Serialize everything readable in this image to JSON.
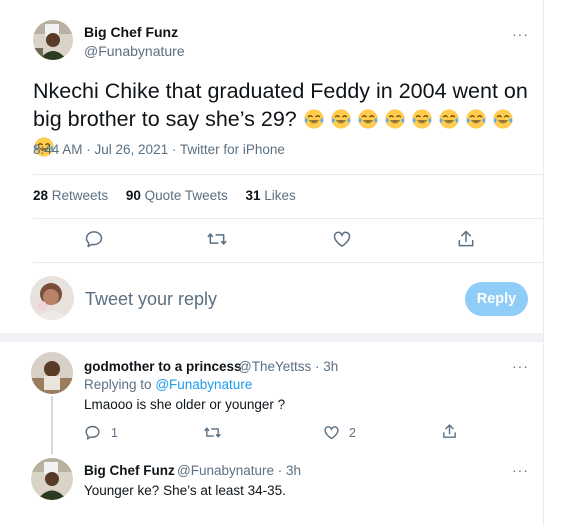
{
  "tweet": {
    "author_name": "Big Chef Funz",
    "author_handle": "@Funabynature",
    "text": "Nkechi Chike that graduated Feddy in 2004 went on big brother to say she’s 29?",
    "emoji_count_icons": "face-with-tears-of-joy",
    "timestamp": "8:44 AM · Jul 26, 2021 · Twitter for iPhone",
    "retweets_num": "28",
    "retweets_label": "Retweets",
    "quotes_num": "90",
    "quotes_label": "Quote Tweets",
    "likes_num": "31",
    "likes_label": "Likes",
    "more": "···"
  },
  "composer": {
    "placeholder": "Tweet your reply",
    "reply_button": "Reply"
  },
  "replies": [
    {
      "author_name": "godmother to a princess",
      "author_handle": "@TheYettss · 3h",
      "replying_prefix": "Replying to",
      "replying_to": "@Funabynature",
      "text": "Lmaooo is she older or younger ?",
      "reply_count": "1",
      "like_count": "2",
      "more": "···"
    },
    {
      "author_name": "Big Chef Funz",
      "author_handle": "@Funabynature · 3h",
      "text": "Younger ke? She’s at least 34-35.",
      "more": "···"
    }
  ],
  "colors": {
    "accent": "#1d9bf0",
    "reply_button_disabled": "#8ecdf8",
    "secondary_text": "#5b7083"
  }
}
